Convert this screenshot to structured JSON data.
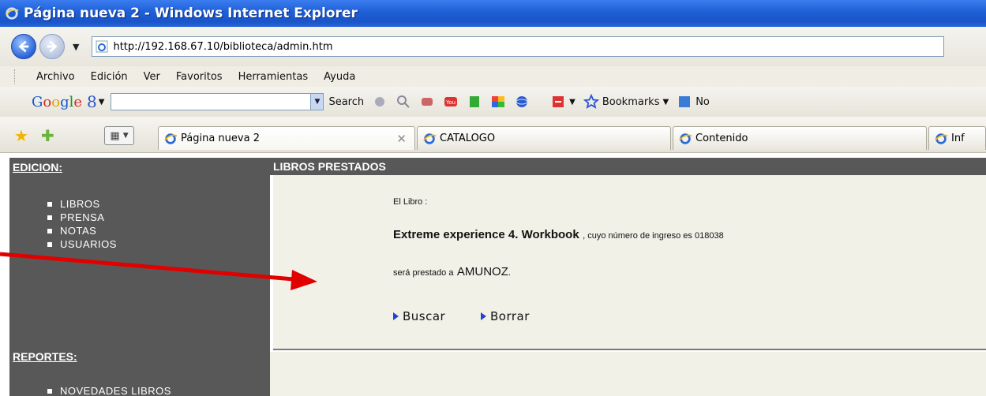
{
  "window": {
    "title": "Página nueva 2 - Windows Internet Explorer"
  },
  "address_bar": {
    "url": "http://192.168.67.10/biblioteca/admin.htm"
  },
  "menu": [
    "Archivo",
    "Edición",
    "Ver",
    "Favoritos",
    "Herramientas",
    "Ayuda"
  ],
  "google_toolbar": {
    "logo": "Google",
    "search_label": "Search",
    "bookmarks_label": "Bookmarks",
    "more_label": "No"
  },
  "tabs": [
    {
      "label": "Página nueva 2",
      "active": true
    },
    {
      "label": "CATALOGO",
      "active": false
    },
    {
      "label": "Contenido",
      "active": false
    },
    {
      "label": "Inf",
      "active": false
    }
  ],
  "sidebar": {
    "edicion_header": "EDICION:",
    "edicion_items": [
      "LIBROS",
      "PRENSA",
      "NOTAS",
      "USUARIOS"
    ],
    "reportes_header": "REPORTES:",
    "reportes_items": [
      "NOVEDADES LIBROS"
    ]
  },
  "main": {
    "header": "LIBROS PRESTADOS",
    "line1": "El Libro :",
    "book_title": "Extreme experience 4. Workbook",
    "ingreso_text": ", cuyo número de ingreso es 018038",
    "prestado_text": "será prestado a",
    "user": "AMUNOZ",
    "period": ".",
    "buscar_label": "Buscar",
    "borrar_label": "Borrar"
  },
  "colors": {
    "sidebar_bg": "#585858",
    "panel_bg": "#f2f1e8",
    "annotation_arrow": "#e00000"
  }
}
